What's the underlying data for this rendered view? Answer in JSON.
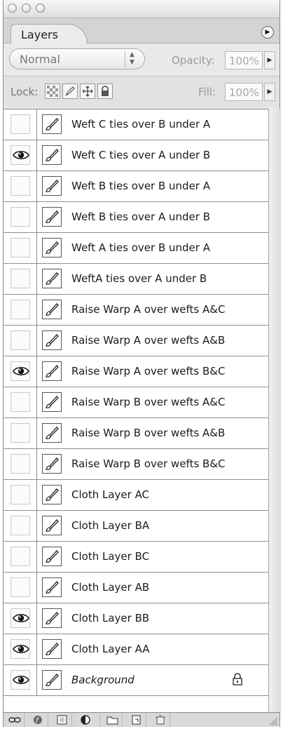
{
  "panel": {
    "tab_label": "Layers",
    "menu_icon": "panel-menu-arrow-icon"
  },
  "blend": {
    "mode": "Normal",
    "opacity_label": "Opacity:",
    "opacity_value": "100%"
  },
  "lock": {
    "label": "Lock:",
    "fill_label": "Fill:",
    "fill_value": "100%"
  },
  "layers": [
    {
      "name": "Weft C ties over B under A",
      "visible": false
    },
    {
      "name": "Weft C ties over A under B",
      "visible": true
    },
    {
      "name": "Weft B ties over B under A",
      "visible": false
    },
    {
      "name": "Weft B ties over A under B",
      "visible": false
    },
    {
      "name": "Weft A ties over B under A",
      "visible": false
    },
    {
      "name": "WeftA ties over A under B",
      "visible": false
    },
    {
      "name": "Raise Warp A over wefts A&C",
      "visible": false
    },
    {
      "name": "Raise Warp A over wefts A&B",
      "visible": false
    },
    {
      "name": "Raise Warp A over wefts B&C",
      "visible": true
    },
    {
      "name": "Raise Warp B over wefts A&C",
      "visible": false
    },
    {
      "name": "Raise Warp B over wefts A&B",
      "visible": false
    },
    {
      "name": "Raise Warp B over wefts B&C",
      "visible": false
    },
    {
      "name": "Cloth Layer AC",
      "visible": false
    },
    {
      "name": "Cloth Layer BA",
      "visible": false
    },
    {
      "name": "Cloth Layer BC",
      "visible": false
    },
    {
      "name": "Cloth Layer AB",
      "visible": false
    },
    {
      "name": "Cloth Layer BB",
      "visible": true
    },
    {
      "name": "Cloth Layer AA",
      "visible": true
    },
    {
      "name": "Background",
      "visible": true,
      "locked": true
    }
  ],
  "bottom_icons": [
    "link-layers-icon",
    "layer-style-icon",
    "layer-mask-icon",
    "adjustment-layer-icon",
    "new-group-icon",
    "new-layer-icon",
    "delete-layer-icon"
  ]
}
